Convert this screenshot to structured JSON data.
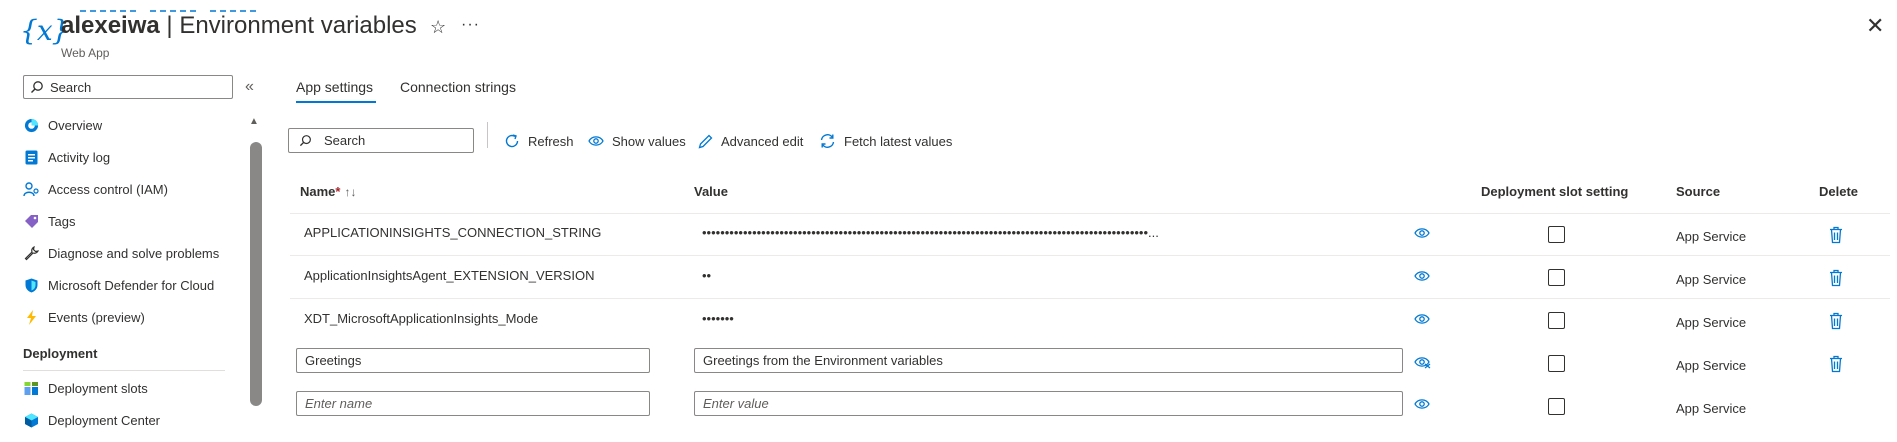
{
  "header": {
    "icon_glyph": "{x}",
    "resource_name": "alexeiwa",
    "separator": " | ",
    "page_title": "Environment variables",
    "subtitle": "Web App",
    "accent_color": "#0078d4"
  },
  "sidebar": {
    "search_placeholder": "Search",
    "items": [
      {
        "label": "Overview",
        "icon": "overview-icon"
      },
      {
        "label": "Activity log",
        "icon": "activity-log-icon"
      },
      {
        "label": "Access control (IAM)",
        "icon": "access-control-icon"
      },
      {
        "label": "Tags",
        "icon": "tag-icon"
      },
      {
        "label": "Diagnose and solve problems",
        "icon": "wrench-icon"
      },
      {
        "label": "Microsoft Defender for Cloud",
        "icon": "shield-icon"
      },
      {
        "label": "Events (preview)",
        "icon": "lightning-icon"
      }
    ],
    "section_title": "Deployment",
    "section_items": [
      {
        "label": "Deployment slots",
        "icon": "deployment-slots-icon"
      },
      {
        "label": "Deployment Center",
        "icon": "deployment-center-icon"
      }
    ]
  },
  "tabs": [
    {
      "label": "App settings",
      "active": true
    },
    {
      "label": "Connection strings",
      "active": false
    }
  ],
  "toolbar": {
    "search_placeholder": "Search",
    "refresh": "Refresh",
    "show_values": "Show values",
    "advanced_edit": "Advanced edit",
    "fetch_latest": "Fetch latest values"
  },
  "table": {
    "headers": {
      "name": "Name",
      "required_mark": "*",
      "sort_glyph": "↑↓",
      "value": "Value",
      "slot_setting": "Deployment slot setting",
      "source": "Source",
      "delete": "Delete"
    },
    "rows": [
      {
        "name": "APPLICATIONINSIGHTS_CONNECTION_STRING",
        "value": "••••••••••••••••••••••••••••••••••••••••••••••••••••••••••••••••••••••••••••••••••••••••••••••••••...",
        "source": "App Service",
        "slot_setting": false
      },
      {
        "name": "ApplicationInsightsAgent_EXTENSION_VERSION",
        "value": "••",
        "source": "App Service",
        "slot_setting": false
      },
      {
        "name": "XDT_MicrosoftApplicationInsights_Mode",
        "value": "•••••••",
        "source": "App Service",
        "slot_setting": false
      }
    ],
    "edit_row": {
      "name": "Greetings",
      "value": "Greetings from the Environment variables",
      "source": "App Service",
      "slot_setting": false
    },
    "new_row": {
      "name_placeholder": "Enter name",
      "value_placeholder": "Enter value",
      "source": "App Service",
      "slot_setting": false
    }
  }
}
